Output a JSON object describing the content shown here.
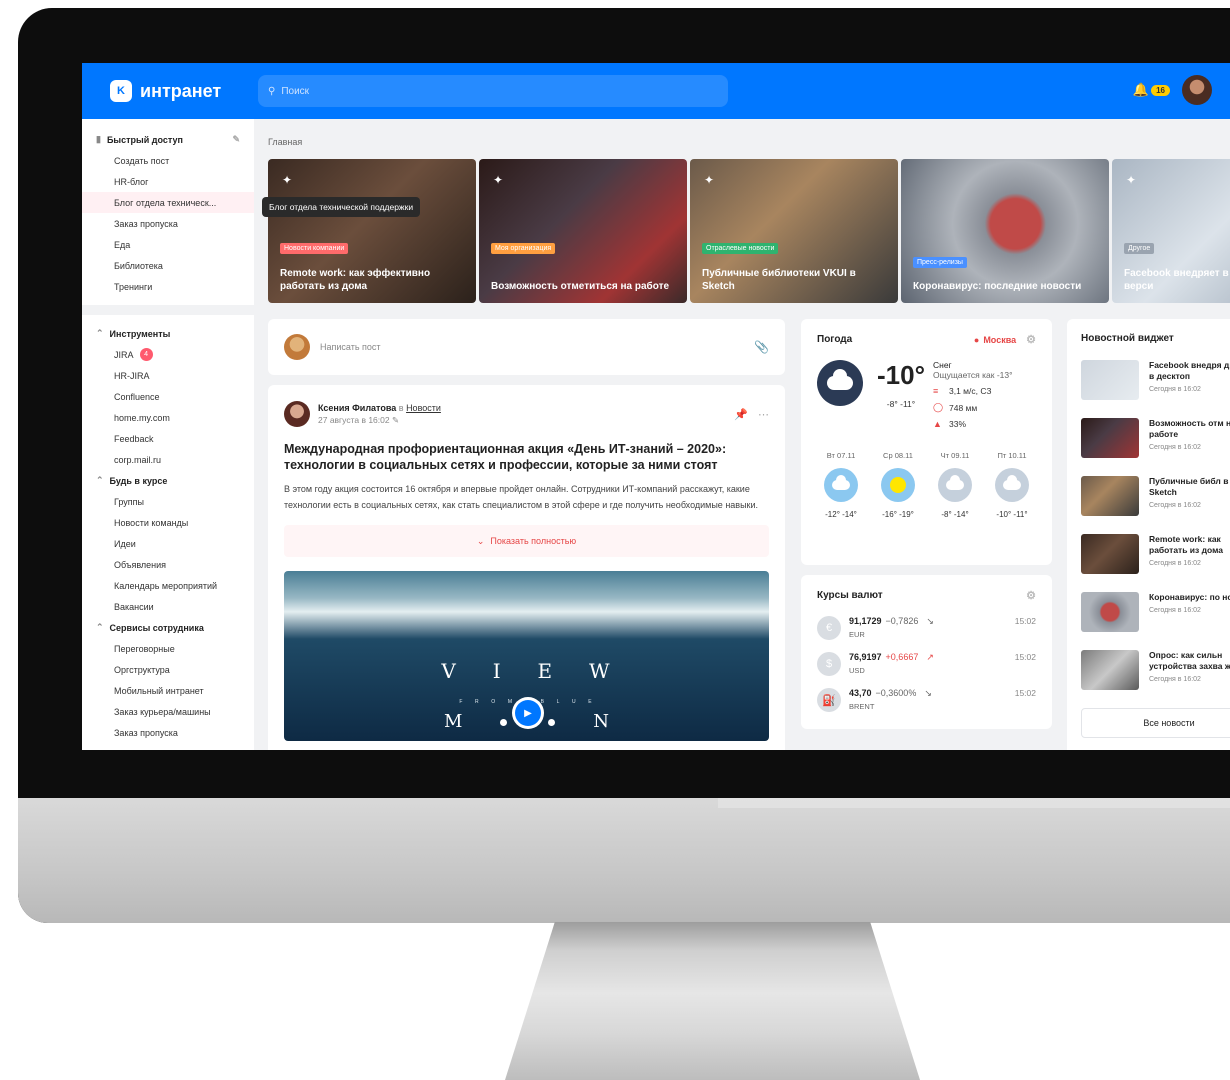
{
  "header": {
    "logo_mark": "K",
    "logo_text": "интранет",
    "search_placeholder": "Поиск",
    "notifications_count": "16"
  },
  "sidebar": {
    "quick_access_title": "Быстрый доступ",
    "quick_items": [
      "Создать пост",
      "HR-блог",
      "Блог отдела техническ...",
      "Заказ пропуска",
      "Еда",
      "Библиотека",
      "Тренинги"
    ],
    "tools_title": "Инструменты",
    "tools_items": [
      "JIRA",
      "HR-JIRA",
      "Confluence",
      "home.my.com",
      "Feedback",
      "corp.mail.ru"
    ],
    "jira_badge": "4",
    "news_title": "Будь в курсе",
    "news_items": [
      "Группы",
      "Новости команды",
      "Идеи",
      "Объявления",
      "Календарь мероприятий",
      "Вакансии"
    ],
    "services_title": "Сервисы сотрудника",
    "services_items": [
      "Переговорные",
      "Оргструктура",
      "Мобильный интранет",
      "Заказ курьера/машины",
      "Заказ пропуска"
    ],
    "tooltip": "Блог отдела технической поддержки"
  },
  "breadcrumb": "Главная",
  "cards": [
    {
      "tag": "Новости компании",
      "tag_color": "#ff6b6b",
      "title": "Remote work: как эффективно работать из дома"
    },
    {
      "tag": "Моя организация",
      "tag_color": "#ff9f40",
      "title": "Возможность отметиться на работе"
    },
    {
      "tag": "Отраслевые новости",
      "tag_color": "#2fb36f",
      "title": "Публичные библиотеки VKUI в Sketch"
    },
    {
      "tag": "Пресс-релизы",
      "tag_color": "#4a90ff",
      "title": "Коронавирус: последние новости"
    },
    {
      "tag": "Другое",
      "tag_color": "#9aa4b0",
      "title": "Facebook внедряет в десктопной верси"
    }
  ],
  "compose": {
    "placeholder": "Написать пост"
  },
  "post": {
    "author": "Ксения Филатова",
    "in": "в",
    "group": "Новости",
    "date": "27 августа в 16:02",
    "title": "Международная профориентационная акция «День ИТ-знаний – 2020»: технологии в социальных сетях и профессии, которые за ними стоят",
    "text": "В этом году акция состоится 16 октября и впервые пройдет онлайн. Сотрудники ИТ-компаний расскажут, какие технологии есть в социальных сетях, как стать специалистом в этой сфере и где получить необходимые навыки.",
    "show_more": "Показать полностью",
    "video_word1": [
      "V",
      "I",
      "E",
      "W"
    ],
    "video_word2": [
      "F",
      "R",
      "O",
      "M",
      "A",
      "B",
      "L",
      "U",
      "E"
    ],
    "video_m": "M",
    "video_n": "N"
  },
  "weather": {
    "title": "Погода",
    "city": "Москва",
    "temp": "-10°",
    "condition": "Снег",
    "feels": "Ощущается как -13°",
    "range": "-8° -11°",
    "wind": "3,1 м/с, СЗ",
    "pressure": "748 мм",
    "humidity": "33%",
    "forecast": [
      {
        "day": "Вт 07.11",
        "range": "-12° -14°",
        "icon": "sun-cloud"
      },
      {
        "day": "Ср 08.11",
        "range": "-16° -19°",
        "icon": "sun"
      },
      {
        "day": "Чт 09.11",
        "range": "-8° -14°",
        "icon": "cloud"
      },
      {
        "day": "Пт 10.11",
        "range": "-10° -11°",
        "icon": "cloud"
      }
    ]
  },
  "rates": {
    "title": "Курсы валют",
    "items": [
      {
        "symbol": "€",
        "value": "91,1729",
        "delta": "−0,7826",
        "trend": "down",
        "currency": "EUR",
        "time": "15:02"
      },
      {
        "symbol": "$",
        "value": "76,9197",
        "delta": "+0,6667",
        "trend": "up",
        "currency": "USD",
        "time": "15:02"
      },
      {
        "symbol": "⛽",
        "value": "43,70",
        "delta": "−0,3600%",
        "trend": "down",
        "currency": "BRENT",
        "time": "15:02"
      }
    ]
  },
  "news_widget": {
    "title": "Новостной виджет",
    "items": [
      {
        "title": "Facebook внедря дизайн в десктоп",
        "time": "Сегодня в 16:02"
      },
      {
        "title": "Возможность отм на работе",
        "time": "Сегодня в 16:02"
      },
      {
        "title": "Публичные библ в Sketch",
        "time": "Сегодня в 16:02"
      },
      {
        "title": "Remote work: как работать из дома",
        "time": "Сегодня в 16:02"
      },
      {
        "title": "Коронавирус: по новости",
        "time": "Сегодня в 16:02"
      },
      {
        "title": "Опрос: как сильн устройства захва жизнь?",
        "time": "Сегодня в 16:02"
      }
    ],
    "all_label": "Все новости"
  }
}
